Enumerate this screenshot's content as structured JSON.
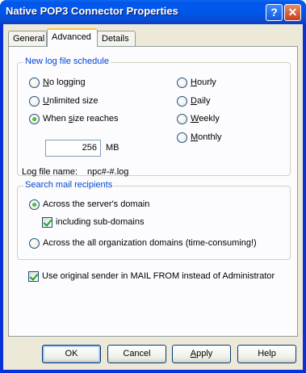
{
  "window": {
    "title": "Native POP3 Connector Properties",
    "help_glyph": "?",
    "close_glyph": "✕"
  },
  "tabs": [
    {
      "label": "General",
      "active": false
    },
    {
      "label": "Advanced",
      "active": true
    },
    {
      "label": "Details",
      "active": false
    }
  ],
  "log_schedule": {
    "group_label": "New log file schedule",
    "options_left": [
      {
        "pre": "",
        "ul": "N",
        "post": "o logging",
        "checked": false
      },
      {
        "pre": "",
        "ul": "U",
        "post": "nlimited size",
        "checked": false
      },
      {
        "pre": "When ",
        "ul": "s",
        "post": "ize reaches",
        "checked": true
      }
    ],
    "options_right": [
      {
        "pre": "",
        "ul": "H",
        "post": "ourly",
        "checked": false
      },
      {
        "pre": "",
        "ul": "D",
        "post": "aily",
        "checked": false
      },
      {
        "pre": "",
        "ul": "W",
        "post": "eekly",
        "checked": false
      },
      {
        "pre": "",
        "ul": "M",
        "post": "onthly",
        "checked": false
      }
    ],
    "size_value": "256",
    "size_unit": "MB",
    "log_file_name_label": "Log file name:",
    "log_file_name_value": "npc#-#.log"
  },
  "search_recipients": {
    "group_label": "Search mail recipients",
    "option_server": "Across the server's domain",
    "option_server_checked": true,
    "subdomains_label": "including sub-domains",
    "subdomains_checked": true,
    "option_all": "Across the all organization domains (time-consuming!)",
    "option_all_checked": false
  },
  "original_sender": {
    "label": "Use original sender in MAIL FROM instead of Administrator",
    "checked": true
  },
  "buttons": {
    "ok": "OK",
    "cancel": "Cancel",
    "apply_ul": "A",
    "apply_rest": "pply",
    "help": "Help"
  }
}
